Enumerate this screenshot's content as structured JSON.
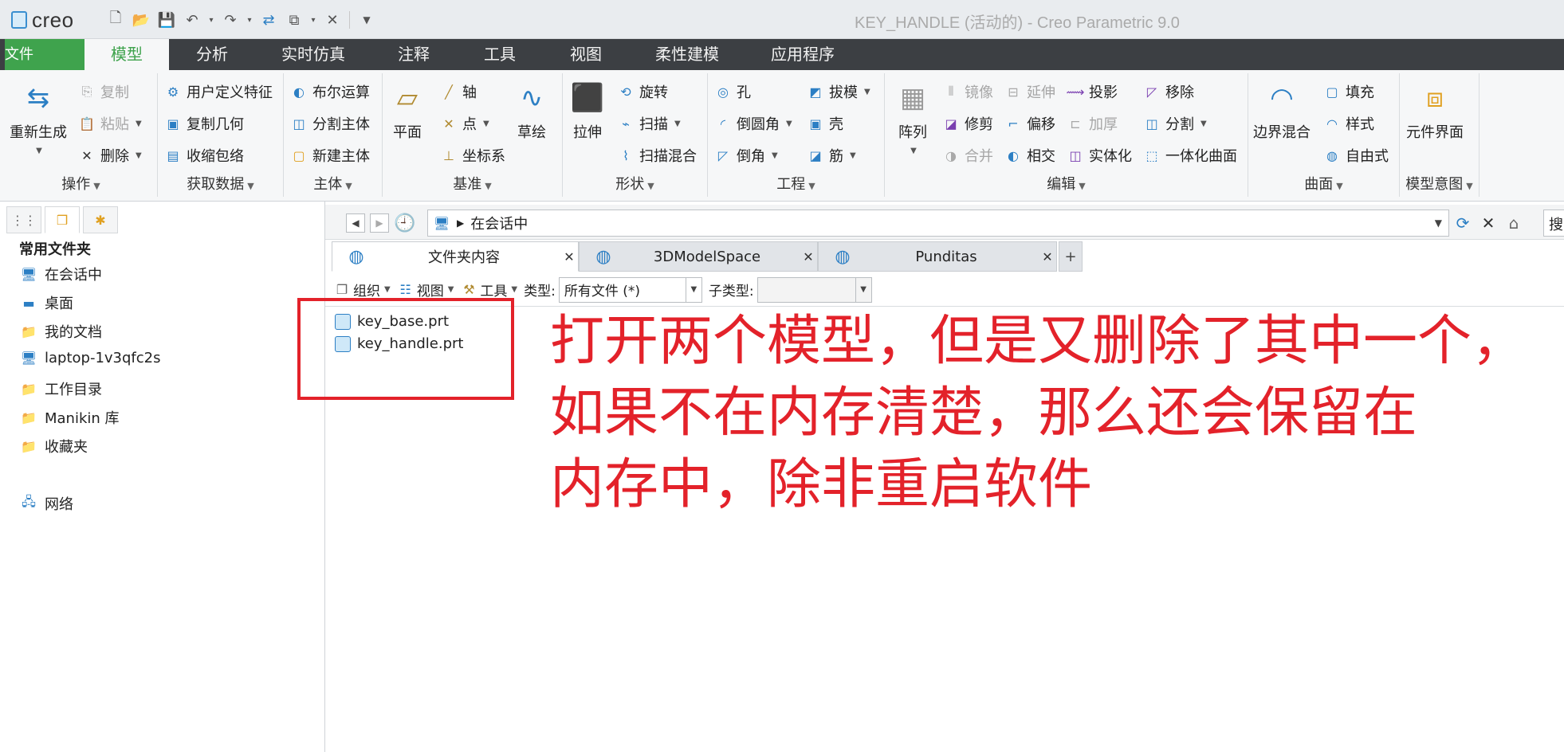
{
  "app": {
    "logo_text": "creo",
    "window_title": "KEY_HANDLE (活动的) - Creo Parametric 9.0",
    "quick_access": [
      "new-file-icon",
      "open-folder-icon",
      "save-icon",
      "undo-icon",
      "redo-icon",
      "regenerate-icon",
      "windows-icon",
      "close-window-icon",
      "customize-icon"
    ]
  },
  "ribbon_tabs": [
    "文件",
    "模型",
    "分析",
    "实时仿真",
    "注释",
    "工具",
    "视图",
    "柔性建模",
    "应用程序"
  ],
  "ribbon": {
    "operations": {
      "label": "操作",
      "regenerate": "重新生成",
      "copy": "复制",
      "paste": "粘贴",
      "delete": "删除"
    },
    "get_data": {
      "label": "获取数据",
      "udf": "用户定义特征",
      "copy_geom": "复制几何",
      "shrinkwrap": "收缩包络"
    },
    "body": {
      "label": "主体",
      "boolean": "布尔运算",
      "split_body": "分割主体",
      "new_body": "新建主体"
    },
    "datum": {
      "label": "基准",
      "plane": "平面",
      "axis": "轴",
      "point": "点",
      "csys": "坐标系",
      "sketch": "草绘"
    },
    "shapes": {
      "label": "形状",
      "extrude": "拉伸",
      "revolve": "旋转",
      "sweep": "扫描",
      "swept_blend": "扫描混合"
    },
    "engineering": {
      "label": "工程",
      "hole": "孔",
      "round": "倒圆角",
      "chamfer": "倒角",
      "draft": "拔模",
      "shell": "壳",
      "rib": "筋"
    },
    "editing": {
      "label": "编辑",
      "pattern": "阵列",
      "mirror": "镜像",
      "trim": "修剪",
      "merge": "合并",
      "extend": "延伸",
      "offset": "偏移",
      "intersect": "相交",
      "project": "投影",
      "thicken": "加厚",
      "solidify": "实体化",
      "remove": "移除",
      "split": "分割",
      "unify": "一体化曲面"
    },
    "surfaces": {
      "label": "曲面",
      "boundary_blend": "边界混合",
      "fill": "填充",
      "style": "样式",
      "freestyle": "自由式"
    },
    "model_intent": {
      "label": "模型意图",
      "component_interface": "元件界面"
    }
  },
  "sidebar": {
    "heading": "常用文件夹",
    "items": [
      {
        "label": "在会话中",
        "icon": "monitor-icon"
      },
      {
        "label": "桌面",
        "icon": "desktop-icon"
      },
      {
        "label": "我的文档",
        "icon": "documents-icon"
      },
      {
        "label": "laptop-1v3qfc2s",
        "icon": "computer-icon"
      },
      {
        "label": "工作目录",
        "icon": "working-directory-icon"
      },
      {
        "label": "Manikin 库",
        "icon": "library-icon"
      },
      {
        "label": "收藏夹",
        "icon": "favorites-icon"
      },
      {
        "label": "网络",
        "icon": "network-icon"
      }
    ]
  },
  "browser": {
    "address": "在会话中",
    "search_text": "搜索",
    "tabs": [
      {
        "label": "文件夹内容"
      },
      {
        "label": "3DModelSpace"
      },
      {
        "label": "Punditas"
      }
    ],
    "toolbar": {
      "organize": "组织",
      "view": "视图",
      "tools": "工具",
      "type_label": "类型:",
      "type_value": "所有文件 (*)",
      "subtype_label": "子类型:",
      "subtype_value": ""
    },
    "files": [
      "key_base.prt",
      "key_handle.prt"
    ]
  },
  "annotation": {
    "color": "#e3222a",
    "lines": [
      "打开两个模型，但是又删除了其中一个，",
      "如果不在内存清楚，那么还会保留在",
      "内存中，除非重启软件"
    ]
  }
}
